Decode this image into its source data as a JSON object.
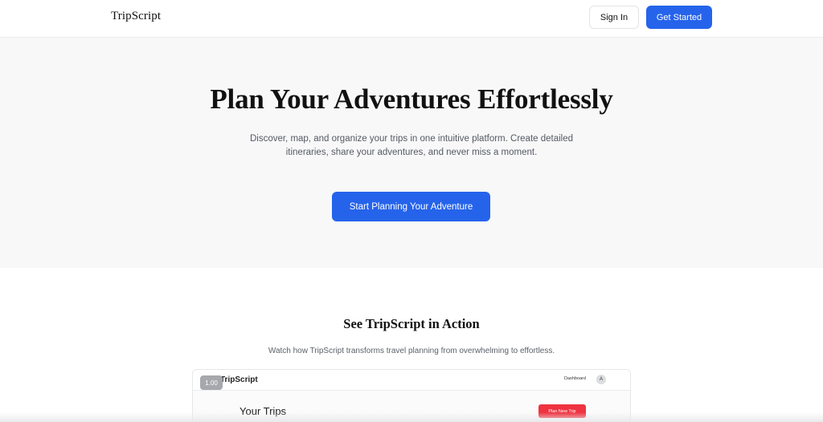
{
  "header": {
    "brand": "TripScript",
    "sign_in_label": "Sign In",
    "get_started_label": "Get Started"
  },
  "hero": {
    "title": "Plan Your Adventures Effortlessly",
    "subtitle": "Discover, map, and organize your trips in one intuitive platform. Create detailed itineraries, share your adventures, and never miss a moment.",
    "cta_label": "Start Planning Your Adventure"
  },
  "demo": {
    "title": "See TripScript in Action",
    "subtitle": "Watch how TripScript transforms travel planning from overwhelming to effortless.",
    "video": {
      "playback_speed": "1.00",
      "brand": "TripScript",
      "nav_link": "Dashboard",
      "avatar_initial": "A",
      "heading": "Your Trips",
      "new_trip_label": "Plan New Trip"
    }
  },
  "colors": {
    "accent": "#2563eb",
    "danger": "#ef3340",
    "hero_bg": "#f8f8f9"
  }
}
